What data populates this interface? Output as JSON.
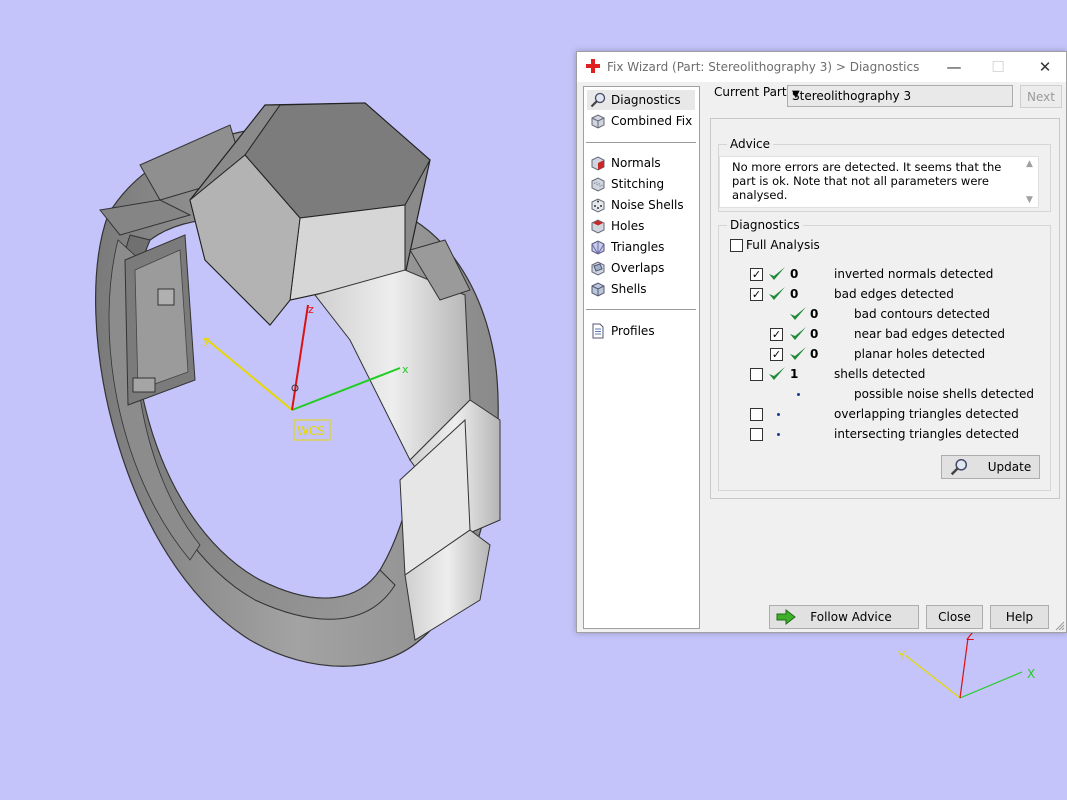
{
  "window": {
    "title": "Fix Wizard (Part: Stereolithography 3) > Diagnostics",
    "controls": {
      "minimize": "—",
      "maximize": "☐",
      "close": "✕"
    }
  },
  "viewport": {
    "wcs_label": "WCS",
    "axis_labels": {
      "x": "x",
      "y": "y",
      "z": "z"
    },
    "corner_axis_labels": {
      "x": "X",
      "y": "Y",
      "z": "Z"
    }
  },
  "nav": {
    "items": [
      {
        "label": "Diagnostics",
        "icon": "magnifier-icon",
        "selected": true
      },
      {
        "label": "Combined Fix",
        "icon": "cube-icon"
      },
      {
        "label": "Normals",
        "icon": "red-face-cube-icon"
      },
      {
        "label": "Stitching",
        "icon": "stitch-cube-icon"
      },
      {
        "label": "Noise Shells",
        "icon": "dice-icon"
      },
      {
        "label": "Holes",
        "icon": "hole-cube-icon"
      },
      {
        "label": "Triangles",
        "icon": "triangles-cube-icon"
      },
      {
        "label": "Overlaps",
        "icon": "overlap-cube-icon"
      },
      {
        "label": "Shells",
        "icon": "shell-cube-icon"
      },
      {
        "label": "Profiles",
        "icon": "document-icon"
      }
    ]
  },
  "current_part": {
    "label": "Current Part:",
    "value": "Stereolithography 3",
    "next_label": "Next"
  },
  "advice": {
    "title": "Advice",
    "text": "No more errors are detected. It seems that the part is ok. Note that not all parameters were analysed."
  },
  "diagnostics": {
    "title": "Diagnostics",
    "full_analysis_label": "Full Analysis",
    "full_analysis_checked": false,
    "rows": [
      {
        "checkbox": true,
        "checked": true,
        "status": "ok",
        "count": "0",
        "label": "inverted normals detected"
      },
      {
        "checkbox": true,
        "checked": true,
        "status": "ok",
        "count": "0",
        "label": "bad edges detected"
      },
      {
        "checkbox": false,
        "status": "ok",
        "count": "0",
        "label": "bad contours detected"
      },
      {
        "checkbox": true,
        "checked": true,
        "status": "ok",
        "count": "0",
        "label": "near bad edges detected"
      },
      {
        "checkbox": true,
        "checked": true,
        "status": "ok",
        "count": "0",
        "label": "planar holes detected"
      },
      {
        "checkbox": true,
        "checked": false,
        "status": "ok",
        "count": "1",
        "label": "shells detected"
      },
      {
        "checkbox": false,
        "status": "pending",
        "count": "",
        "label": "possible noise shells detected"
      },
      {
        "checkbox": true,
        "checked": false,
        "status": "pending",
        "count": "",
        "label": "overlapping triangles detected"
      },
      {
        "checkbox": true,
        "checked": false,
        "status": "pending",
        "count": "",
        "label": "intersecting triangles detected"
      }
    ],
    "update_label": "Update"
  },
  "footer": {
    "follow_advice_label": "Follow Advice",
    "close_label": "Close",
    "help_label": "Help"
  },
  "colors": {
    "background": "#c4c4fa",
    "axis_x": "#22cc22",
    "axis_y": "#e6d800",
    "axis_z": "#dd1111",
    "check_green": "#1f8a3a"
  }
}
